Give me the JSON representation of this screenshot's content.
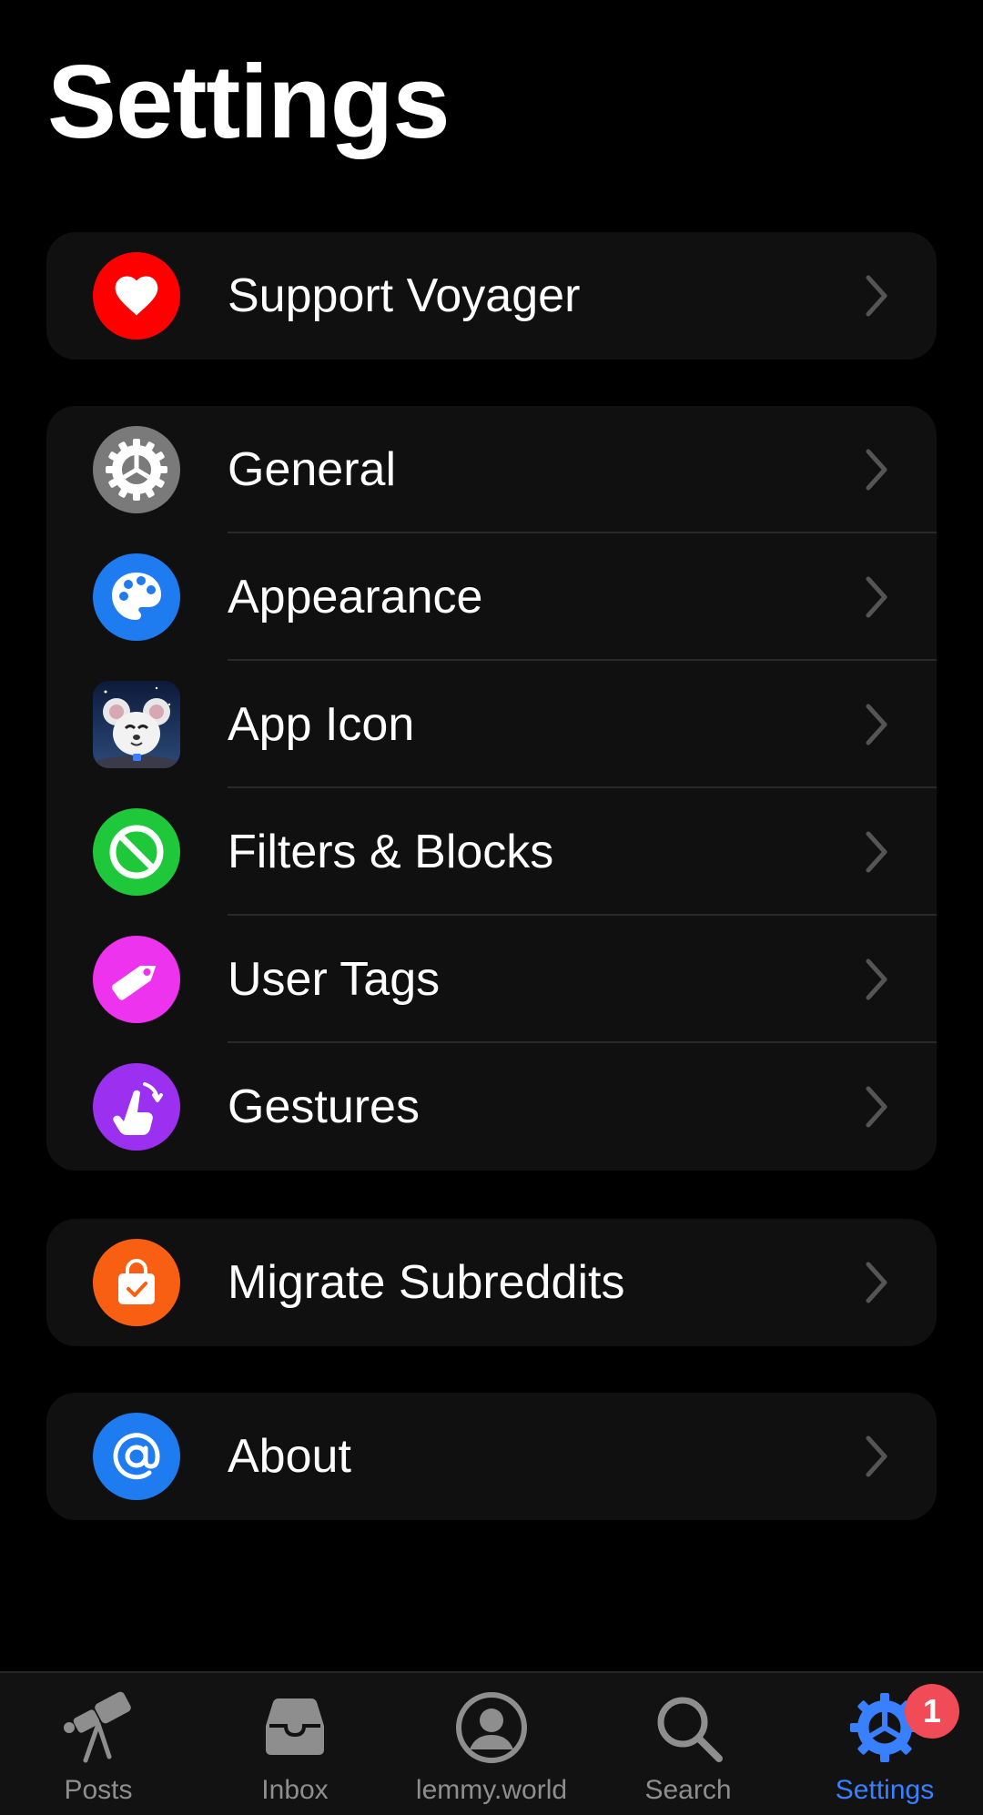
{
  "page": {
    "title": "Settings"
  },
  "groups": [
    {
      "items": [
        {
          "label": "Support Voyager",
          "icon": "heart-icon",
          "color": "#ff0000"
        }
      ]
    },
    {
      "items": [
        {
          "label": "General",
          "icon": "gear-icon",
          "color": "#7a7a7a"
        },
        {
          "label": "Appearance",
          "icon": "palette-icon",
          "color": "#1e7bf0"
        },
        {
          "label": "App Icon",
          "icon": "app-icon-thumbnail",
          "color": "#1b2a4a"
        },
        {
          "label": "Filters & Blocks",
          "icon": "block-icon",
          "color": "#1ec83a"
        },
        {
          "label": "User Tags",
          "icon": "tag-icon",
          "color": "#ee33ee"
        },
        {
          "label": "Gestures",
          "icon": "hand-swipe-icon",
          "color": "#9b30f0"
        }
      ]
    },
    {
      "items": [
        {
          "label": "Migrate Subreddits",
          "icon": "shopping-bag-check-icon",
          "color": "#f95f13"
        }
      ]
    },
    {
      "items": [
        {
          "label": "About",
          "icon": "at-sign-icon",
          "color": "#1e7bf0"
        }
      ]
    }
  ],
  "tabbar": {
    "tabs": [
      {
        "label": "Posts",
        "icon": "telescope-icon",
        "active": false
      },
      {
        "label": "Inbox",
        "icon": "inbox-tray-icon",
        "active": false
      },
      {
        "label": "lemmy.world",
        "icon": "person-circle-icon",
        "active": false
      },
      {
        "label": "Search",
        "icon": "search-icon",
        "active": false
      },
      {
        "label": "Settings",
        "icon": "gear-icon",
        "active": true,
        "badge": "1"
      }
    ],
    "active_color": "#3880ff",
    "inactive_color": "#8e8e8e",
    "badge_color": "#f04b57"
  }
}
